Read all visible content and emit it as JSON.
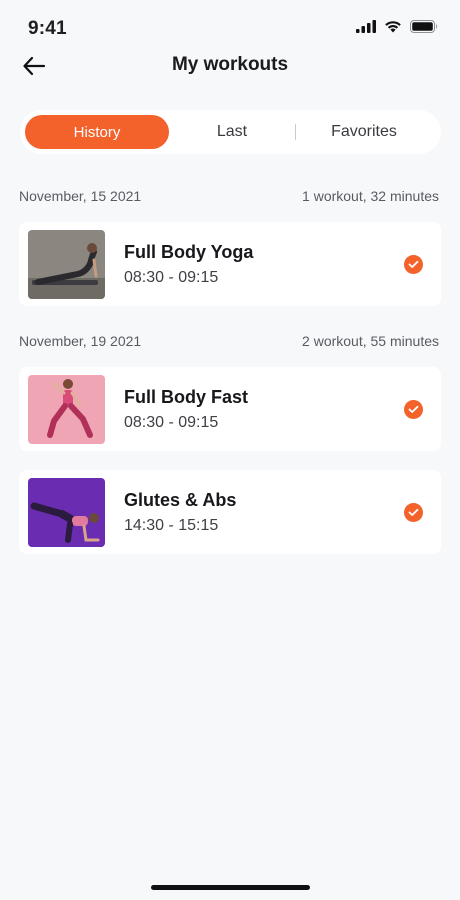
{
  "status": {
    "time": "9:41"
  },
  "header": {
    "title": "My workouts",
    "back_icon": "arrow-left-icon"
  },
  "tabs": [
    {
      "label": "History",
      "active": true
    },
    {
      "label": "Last",
      "active": false
    },
    {
      "label": "Favorites",
      "active": false
    }
  ],
  "accent_color": "#f4622c",
  "sections": [
    {
      "date": "November, 15 2021",
      "summary": "1 workout, 32 minutes",
      "workouts": [
        {
          "title": "Full Body Yoga",
          "time": "08:30 - 09:15",
          "completed": true,
          "image": "yoga-pose-photo"
        }
      ]
    },
    {
      "date": "November, 19 2021",
      "summary": "2 workout, 55 minutes",
      "workouts": [
        {
          "title": "Full Body Fast",
          "time": "08:30 - 09:15",
          "completed": true,
          "image": "pink-workout-photo"
        },
        {
          "title": "Glutes & Abs",
          "time": "14:30 - 15:15",
          "completed": true,
          "image": "purple-glutes-photo"
        }
      ]
    }
  ]
}
